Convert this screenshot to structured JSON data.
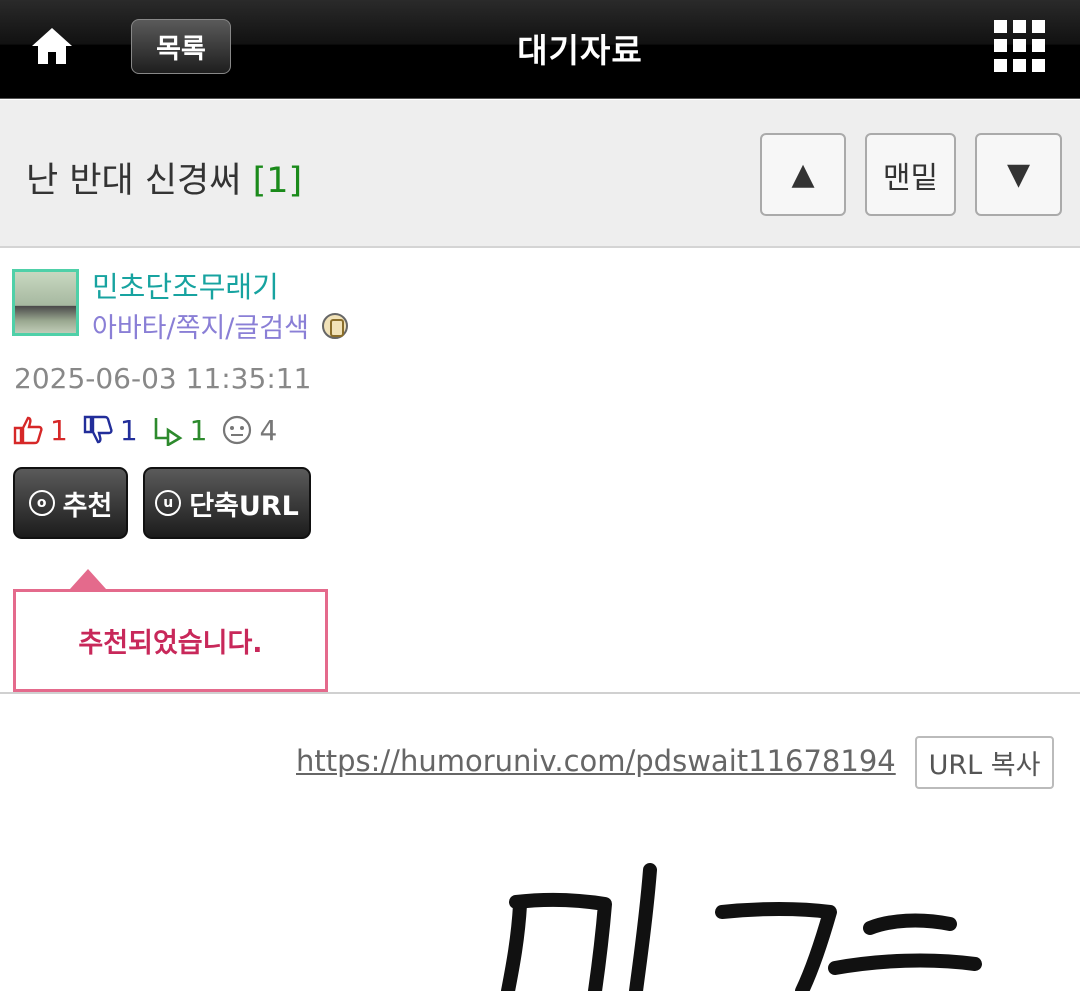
{
  "header": {
    "list_label": "목록",
    "title": "대기자료",
    "home_icon": "home-icon",
    "menu_icon": "grid-menu-icon"
  },
  "post": {
    "subject": "난 반대 신경써",
    "comment_count": "[1]",
    "nav": {
      "up": "▲",
      "bottom": "맨밑",
      "down": "▼"
    },
    "author": "민초단조무래기",
    "author_links": "아바타/쪽지/글검색",
    "date": "2025-06-03 11:35:11",
    "stats": {
      "likes": "1",
      "dislikes": "1",
      "shares": "1",
      "views": "4"
    },
    "recommend_label": "추천",
    "shorturl_label": "단축URL",
    "recommend_icon_letter": "o",
    "shorturl_icon_letter": "u",
    "toast": "추천되었습니다.",
    "short_url": "https://humoruniv.com/pdswait11678194",
    "copy_label": "URL 복사"
  },
  "colors": {
    "author": "#17a3a0",
    "links": "#8a7fd6",
    "toast_border": "#e46a8c",
    "toast_text": "#c8285a",
    "comment_count": "#1a8a1a"
  }
}
